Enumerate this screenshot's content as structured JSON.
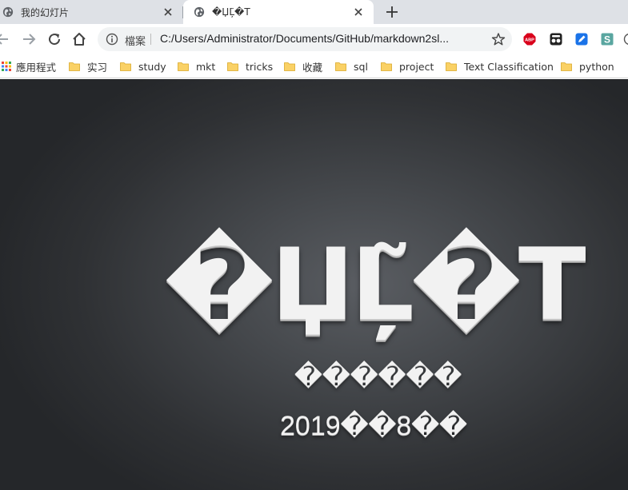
{
  "tabs": [
    {
      "title": "我的幻灯片",
      "active": false
    },
    {
      "title": "�ЏĻ̃�T",
      "active": true
    }
  ],
  "toolbar": {
    "url_label": "檔案",
    "url": "C:/Users/Administrator/Documents/GitHub/markdown2sl..."
  },
  "extensions": [
    {
      "icon": "abp-icon",
      "text": "ABP",
      "color": "#d9001b"
    },
    {
      "icon": "tampermonkey-icon",
      "text": "",
      "color": "#222222"
    },
    {
      "icon": "pen-extension-icon",
      "text": "",
      "color": "#1a73e8"
    },
    {
      "icon": "s-extension-icon",
      "text": "S",
      "color": "#5aa6a0"
    }
  ],
  "bookmarks": [
    {
      "label": "應用程式",
      "icon": "apps-icon"
    },
    {
      "label": "实习",
      "icon": "folder-icon"
    },
    {
      "label": "study",
      "icon": "folder-icon"
    },
    {
      "label": "mkt",
      "icon": "folder-icon"
    },
    {
      "label": "tricks",
      "icon": "folder-icon"
    },
    {
      "label": "收藏",
      "icon": "folder-icon"
    },
    {
      "label": "sql",
      "icon": "folder-icon"
    },
    {
      "label": "project",
      "icon": "folder-icon"
    },
    {
      "label": "Text Classification",
      "icon": "folder-icon"
    },
    {
      "label": "python",
      "icon": "folder-icon"
    }
  ],
  "slide": {
    "title": "�ЏĻ̃�T",
    "subtitle": "������",
    "date": "2019��8��"
  }
}
